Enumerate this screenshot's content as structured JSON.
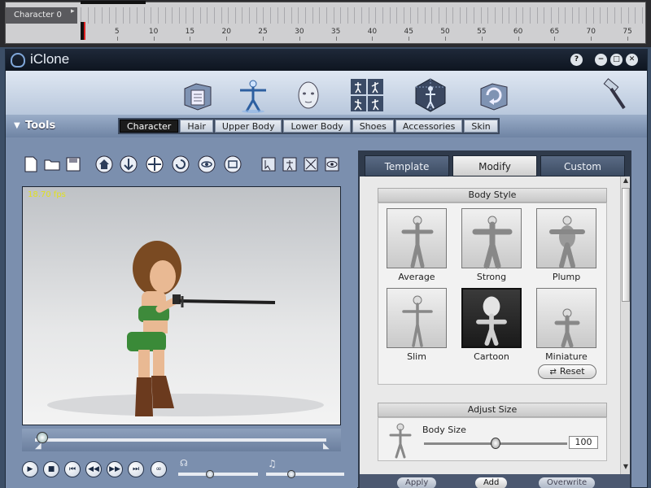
{
  "timeline": {
    "track_label": "Character 0",
    "ruler_ticks": [
      "5",
      "10",
      "15",
      "20",
      "25",
      "30",
      "35",
      "40",
      "45",
      "50",
      "55",
      "60",
      "65",
      "70",
      "75"
    ]
  },
  "window": {
    "title": "iClone",
    "help_label": "?",
    "minimize_label": "−",
    "maximize_label": "□",
    "close_label": "✕"
  },
  "main_toolbar": {
    "icons": [
      "project-icon",
      "actor-icon",
      "face-icon",
      "animation-icon",
      "set-icon",
      "export-icon",
      "hammer-icon"
    ]
  },
  "tools": {
    "label": "Tools",
    "tabs": [
      "Character",
      "Hair",
      "Upper Body",
      "Lower Body",
      "Shoes",
      "Accessories",
      "Skin"
    ],
    "active_tab": "Character"
  },
  "viewport": {
    "fps_text": "18.70 fps"
  },
  "right_panel": {
    "tabs": [
      "Template",
      "Modify",
      "Custom"
    ],
    "active_tab": "Modify",
    "body_style": {
      "title": "Body Style",
      "options": [
        "Average",
        "Strong",
        "Plump",
        "Slim",
        "Cartoon",
        "Miniature"
      ],
      "selected": "Cartoon",
      "reset_label": "Reset"
    },
    "adjust_size": {
      "title": "Adjust Size",
      "body_size_label": "Body Size",
      "body_size_value": "100",
      "body_size_fraction": 0.5
    },
    "bottom_buttons": [
      "Apply",
      "Add",
      "Overwrite"
    ]
  },
  "colors": {
    "panel_bg": "#7b8fae",
    "titlebar": "#0e1520",
    "fps_text": "#e0e020",
    "playhead": "#dd2222"
  }
}
